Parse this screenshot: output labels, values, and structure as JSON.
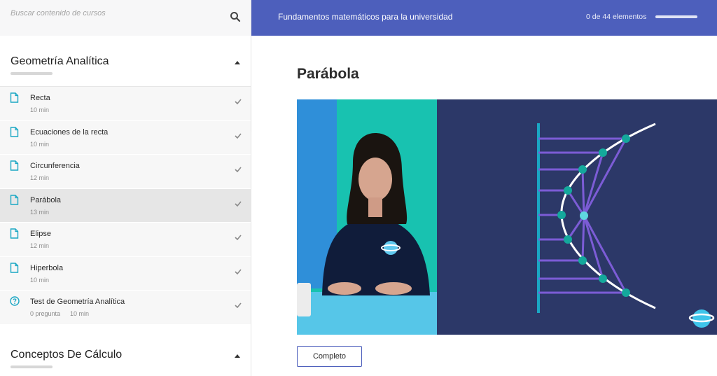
{
  "search": {
    "placeholder": "Buscar contenido de cursos"
  },
  "sections": [
    {
      "title": "Geometría Analítica"
    },
    {
      "title": "Conceptos De Cálculo"
    }
  ],
  "lessons": [
    {
      "name": "Recta",
      "duration": "10 min",
      "icon": "doc-icon"
    },
    {
      "name": "Ecuaciones de la recta",
      "duration": "10 min",
      "icon": "doc-icon"
    },
    {
      "name": "Circunferencia",
      "duration": "12 min",
      "icon": "doc-icon"
    },
    {
      "name": "Parábola",
      "duration": "13 min",
      "icon": "doc-icon",
      "active": true
    },
    {
      "name": "Elipse",
      "duration": "12 min",
      "icon": "doc-icon"
    },
    {
      "name": "Hiperbola",
      "duration": "10 min",
      "icon": "doc-icon"
    },
    {
      "name": "Test de Geometría Analítica",
      "questions": "0 pregunta",
      "duration": "10 min",
      "icon": "question-icon"
    }
  ],
  "topbar": {
    "course_title": "Fundamentos matemáticos para la universidad",
    "progress_text": "0 de 44 elementos",
    "progress": 0
  },
  "main": {
    "lesson_title": "Parábola",
    "complete_label": "Completo"
  },
  "colors": {
    "header": "#4d5fbc",
    "accent": "#1aa7c4",
    "video_dark": "#2c3868",
    "parabola_lines": "#7c5cd6",
    "points": "#14a89c"
  }
}
